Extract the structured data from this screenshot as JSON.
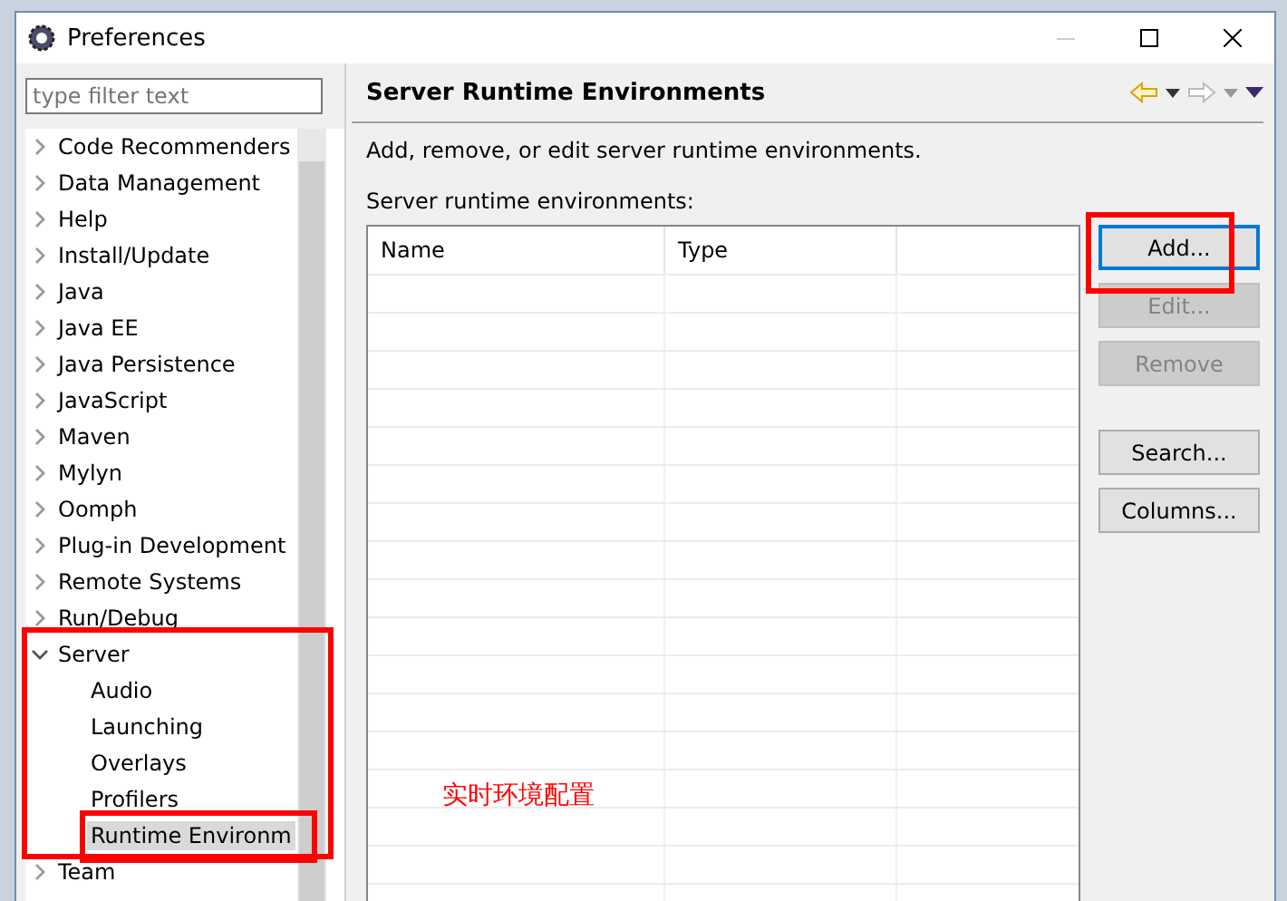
{
  "window": {
    "title": "Preferences"
  },
  "filter": {
    "placeholder": "type filter text"
  },
  "tree": [
    {
      "label": "Code Recommenders",
      "expanded": false,
      "selected": false
    },
    {
      "label": "Data Management",
      "expanded": false,
      "selected": false
    },
    {
      "label": "Help",
      "expanded": false,
      "selected": false
    },
    {
      "label": "Install/Update",
      "expanded": false,
      "selected": false
    },
    {
      "label": "Java",
      "expanded": false,
      "selected": false
    },
    {
      "label": "Java EE",
      "expanded": false,
      "selected": false
    },
    {
      "label": "Java Persistence",
      "expanded": false,
      "selected": false
    },
    {
      "label": "JavaScript",
      "expanded": false,
      "selected": false
    },
    {
      "label": "Maven",
      "expanded": false,
      "selected": false
    },
    {
      "label": "Mylyn",
      "expanded": false,
      "selected": false
    },
    {
      "label": "Oomph",
      "expanded": false,
      "selected": false
    },
    {
      "label": "Plug-in Development",
      "expanded": false,
      "selected": false
    },
    {
      "label": "Remote Systems",
      "expanded": false,
      "selected": false
    },
    {
      "label": "Run/Debug",
      "expanded": false,
      "selected": false
    },
    {
      "label": "Server",
      "expanded": true,
      "selected": false,
      "children": [
        {
          "label": "Audio",
          "selected": false
        },
        {
          "label": "Launching",
          "selected": false
        },
        {
          "label": "Overlays",
          "selected": false
        },
        {
          "label": "Profilers",
          "selected": false
        },
        {
          "label": "Runtime Environm",
          "selected": true
        }
      ]
    },
    {
      "label": "Team",
      "expanded": false,
      "selected": false
    }
  ],
  "page": {
    "title": "Server Runtime Environments",
    "description": "Add, remove, or edit server runtime environments.",
    "list_label": "Server runtime environments:"
  },
  "table": {
    "columns": [
      "Name",
      "Type"
    ]
  },
  "buttons": [
    {
      "label": "Add...",
      "disabled": false,
      "focused": true
    },
    {
      "label": "Edit...",
      "disabled": true,
      "focused": false
    },
    {
      "label": "Remove",
      "disabled": true,
      "focused": false
    },
    {
      "label": "Search...",
      "disabled": false,
      "focused": false
    },
    {
      "label": "Columns...",
      "disabled": false,
      "focused": false
    }
  ],
  "annotation": {
    "note": "实时环境配置"
  }
}
